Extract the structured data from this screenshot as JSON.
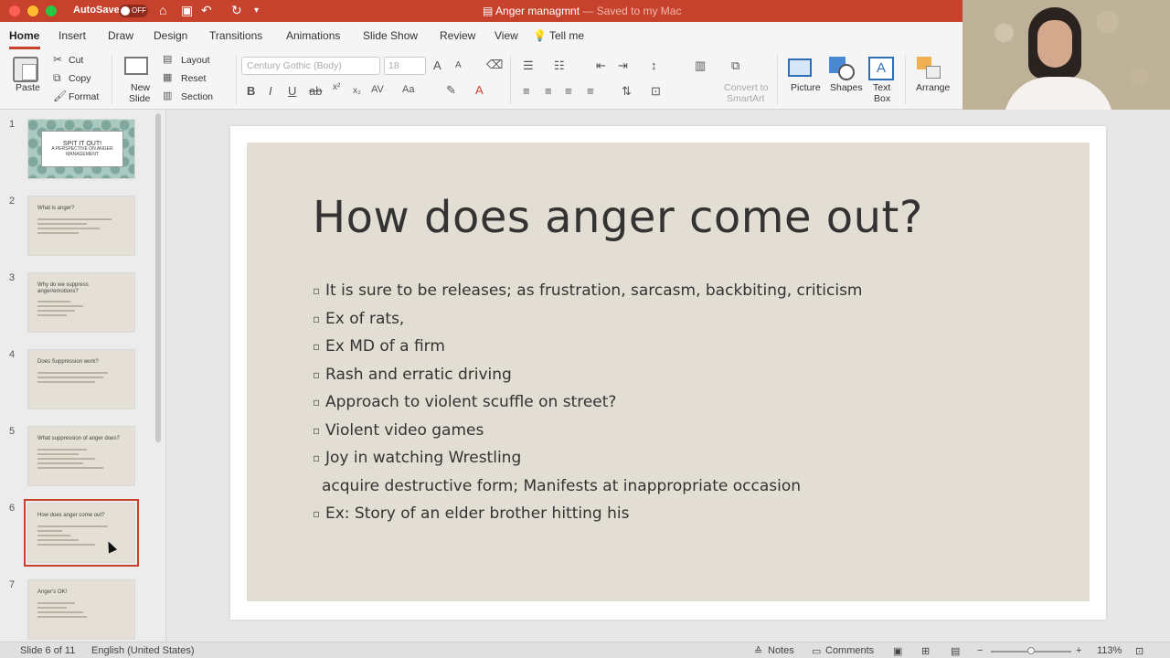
{
  "titlebar": {
    "autosave_label": "AutoSave",
    "autosave_state": "OFF",
    "document_title": "Anger managmnt",
    "saved_status": "— Saved to my Mac"
  },
  "tabs": [
    "Home",
    "Insert",
    "Draw",
    "Design",
    "Transitions",
    "Animations",
    "Slide Show",
    "Review",
    "View",
    "Tell me"
  ],
  "ribbon": {
    "paste": "Paste",
    "cut": "Cut",
    "copy": "Copy",
    "format": "Format",
    "new_slide_1": "New",
    "new_slide_2": "Slide",
    "layout": "Layout",
    "reset": "Reset",
    "section": "Section",
    "font_name": "Century Gothic (Body)",
    "font_size": "18",
    "convert_1": "Convert to",
    "convert_2": "SmartArt",
    "picture": "Picture",
    "shapes": "Shapes",
    "textbox_1": "Text",
    "textbox_2": "Box",
    "arrange": "Arrange"
  },
  "thumbnails": [
    {
      "num": "1",
      "title": "SPIT IT OUT!",
      "subtitle": "A PERSPECTIVE ON ANGER MANAGEMENT"
    },
    {
      "num": "2",
      "title": "What is anger?"
    },
    {
      "num": "3",
      "title": "Why do we suppress anger/emotions?"
    },
    {
      "num": "4",
      "title": "Does Suppression work?"
    },
    {
      "num": "5",
      "title": "What suppression of anger does?"
    },
    {
      "num": "6",
      "title": "How does anger come out?"
    },
    {
      "num": "7",
      "title": "Anger's OK!"
    }
  ],
  "slide": {
    "title": "How does anger come out?",
    "bullets": [
      "It is sure to be releases; as frustration, sarcasm, backbiting, criticism",
      "Ex of rats,",
      "Ex MD of a firm",
      "Rash and erratic driving",
      "Approach to  violent scuffle on street?",
      "Violent video games",
      "Joy in watching Wrestling",
      "acquire destructive form; Manifests at inappropriate occasion",
      "Ex: Story of an elder brother hitting his"
    ]
  },
  "statusbar": {
    "slide_info": "Slide 6 of 11",
    "language": "English (United States)",
    "notes": "Notes",
    "comments": "Comments",
    "zoom": "113%"
  }
}
